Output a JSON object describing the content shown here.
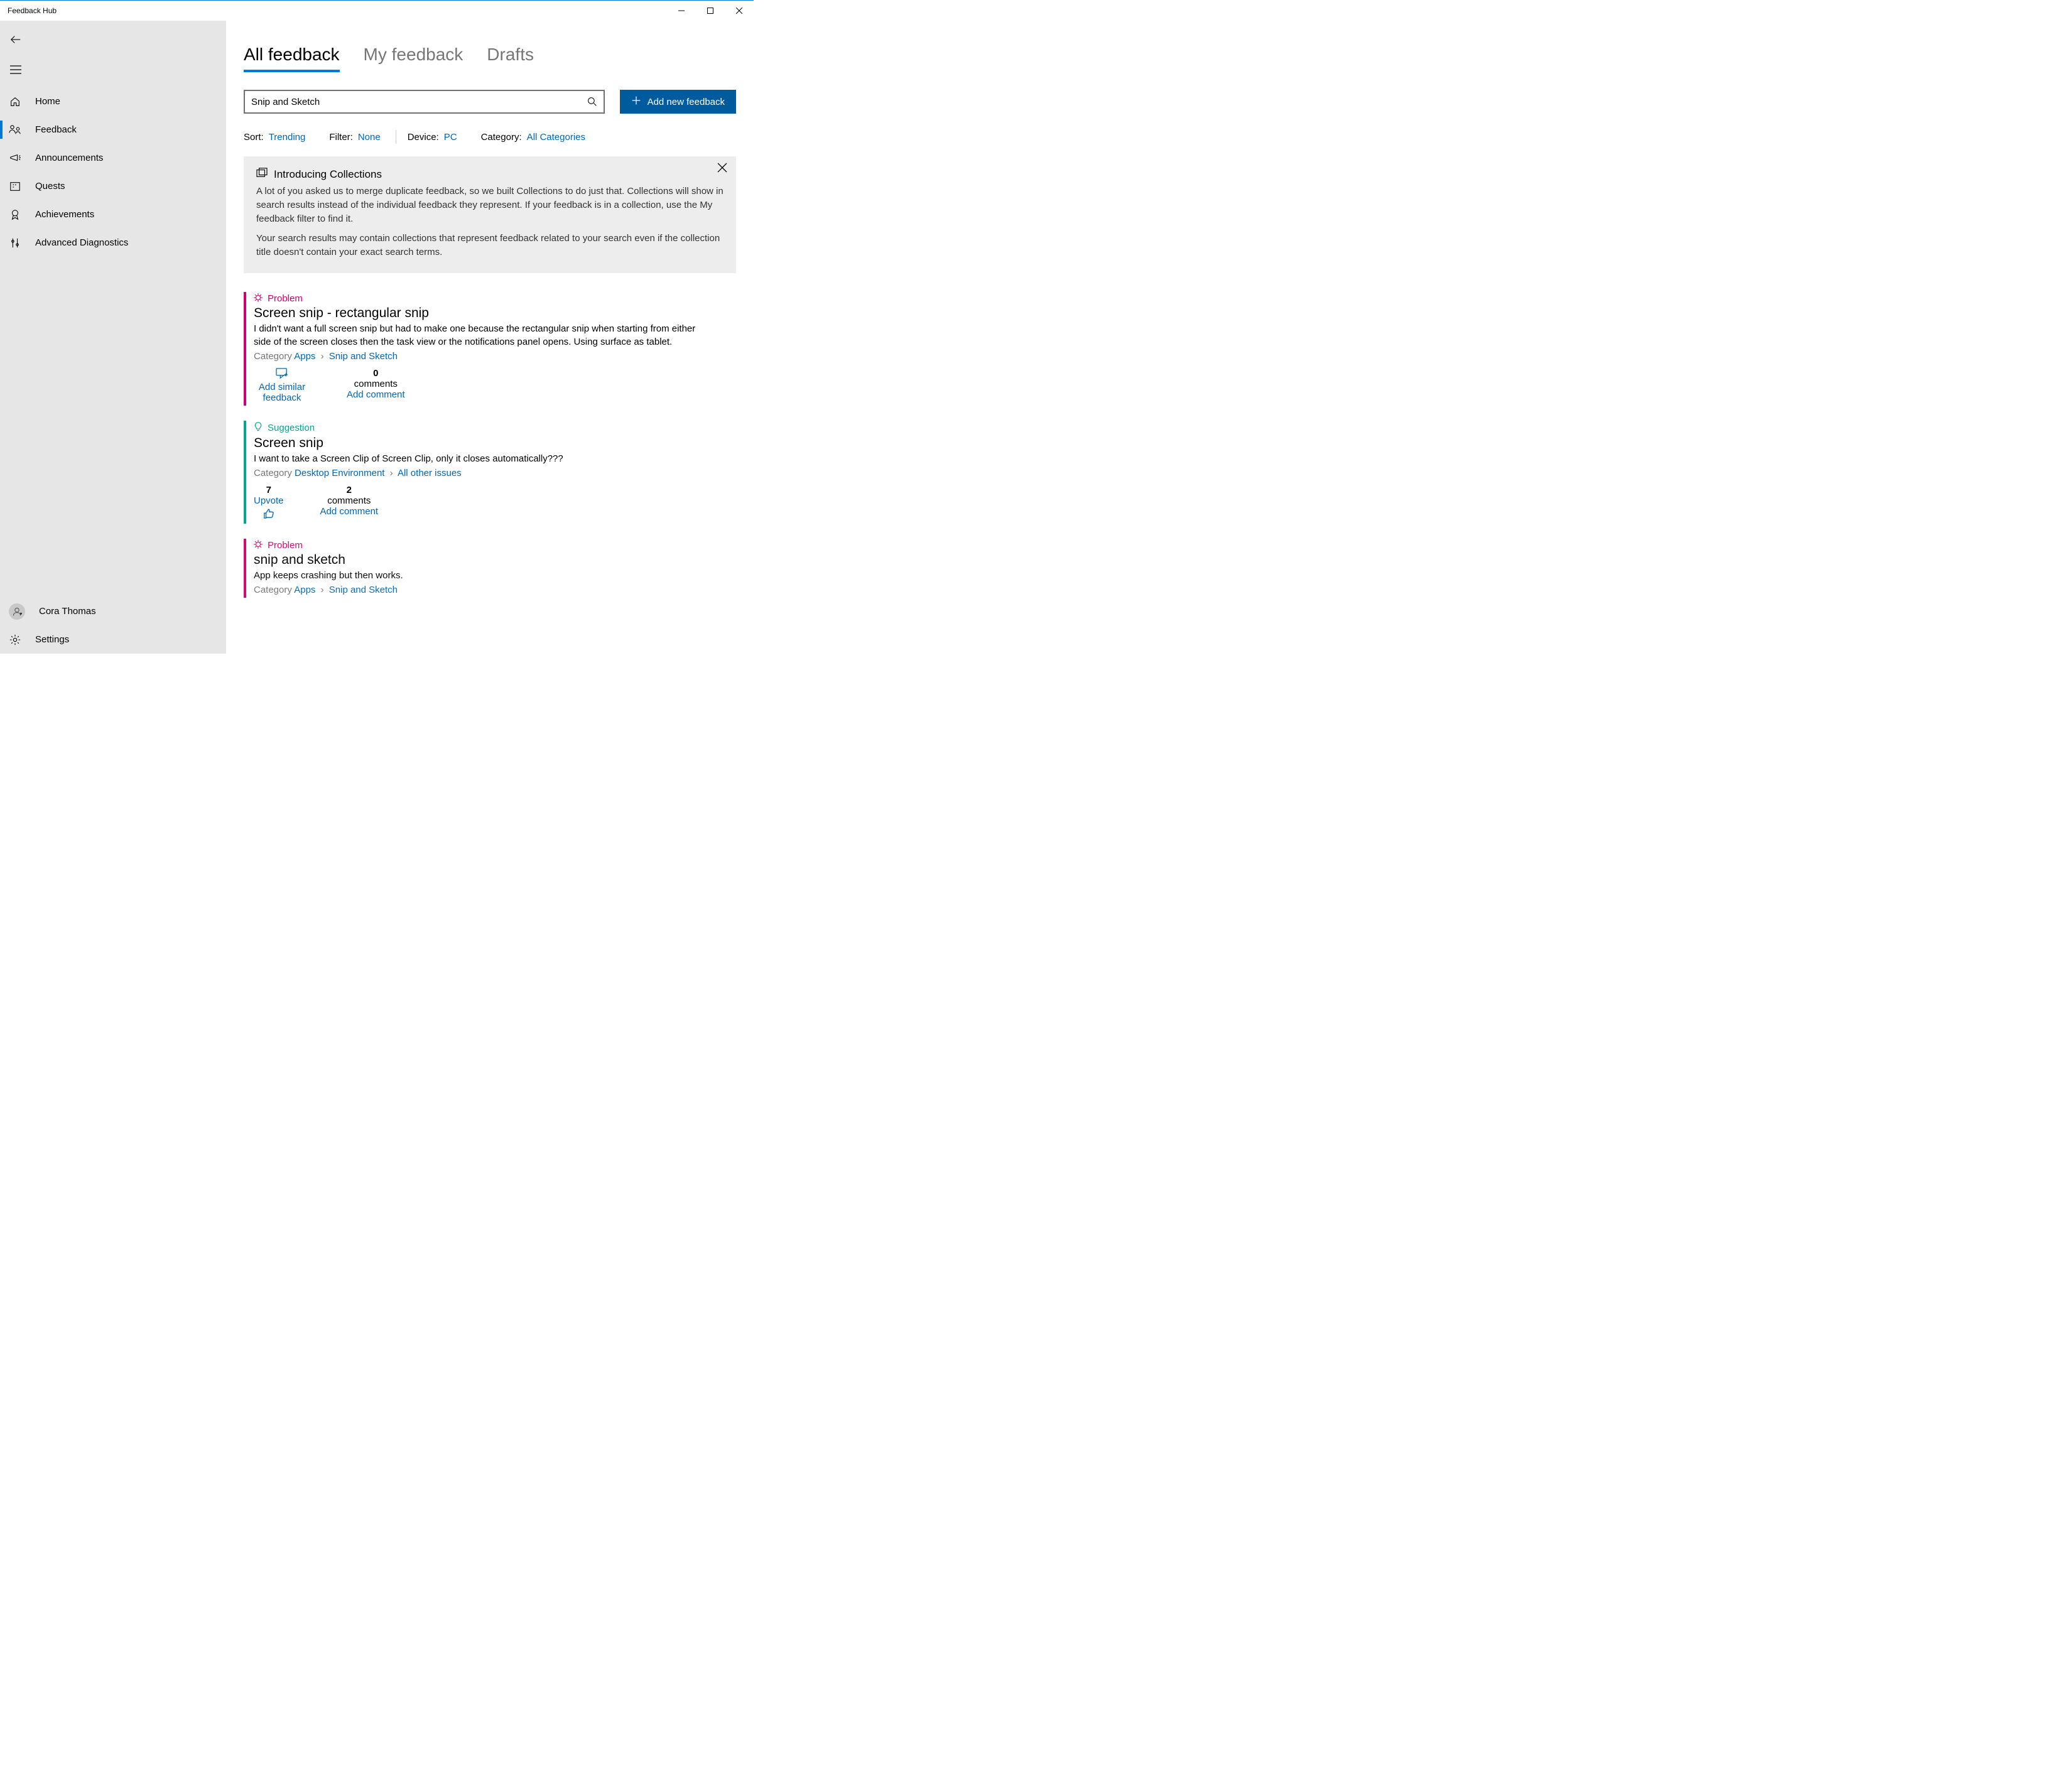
{
  "window": {
    "title": "Feedback Hub"
  },
  "sidebar": {
    "items": [
      {
        "label": "Home"
      },
      {
        "label": "Feedback"
      },
      {
        "label": "Announcements"
      },
      {
        "label": "Quests"
      },
      {
        "label": "Achievements"
      },
      {
        "label": "Advanced Diagnostics"
      }
    ],
    "user": "Cora Thomas",
    "settings": "Settings"
  },
  "tabs": {
    "all": "All feedback",
    "my": "My feedback",
    "drafts": "Drafts"
  },
  "search": {
    "value": "Snip and Sketch"
  },
  "add_button": "Add new feedback",
  "filters": {
    "sort_label": "Sort:",
    "sort_value": "Trending",
    "filter_label": "Filter:",
    "filter_value": "None",
    "device_label": "Device:",
    "device_value": "PC",
    "category_label": "Category:",
    "category_value": "All Categories"
  },
  "banner": {
    "title": "Introducing Collections",
    "p1": "A lot of you asked us to merge duplicate feedback, so we built Collections to do just that. Collections will show in search results instead of the individual feedback they represent. If your feedback is in a collection, use the My feedback filter to find it.",
    "p2": "Your search results may contain collections that represent feedback related to your search even if the collection title doesn't contain your exact search terms."
  },
  "cards": [
    {
      "type": "Problem",
      "title": "Screen snip - rectangular snip",
      "desc": "I didn't want a full screen snip but had to make one because the rectangular snip when starting from either side of the screen closes then the task view or the notifications panel opens. Using surface as tablet.",
      "cat_label": "Category",
      "cat1": "Apps",
      "cat2": "Snip and Sketch",
      "col1_label": "Add similar feedback",
      "col2_num": "0",
      "col2_label": "comments",
      "col2_link": "Add comment"
    },
    {
      "type": "Suggestion",
      "title": "Screen snip",
      "desc": "I want to take a Screen Clip of Screen Clip, only it closes automatically???",
      "cat_label": "Category",
      "cat1": "Desktop Environment",
      "cat2": "All other issues",
      "col1_num": "7",
      "col1_label": "Upvote",
      "col2_num": "2",
      "col2_label": "comments",
      "col2_link": "Add comment"
    },
    {
      "type": "Problem",
      "title": "snip and sketch",
      "desc": "App keeps crashing but then works.",
      "cat_label": "Category",
      "cat1": "Apps",
      "cat2": "Snip and Sketch"
    }
  ]
}
